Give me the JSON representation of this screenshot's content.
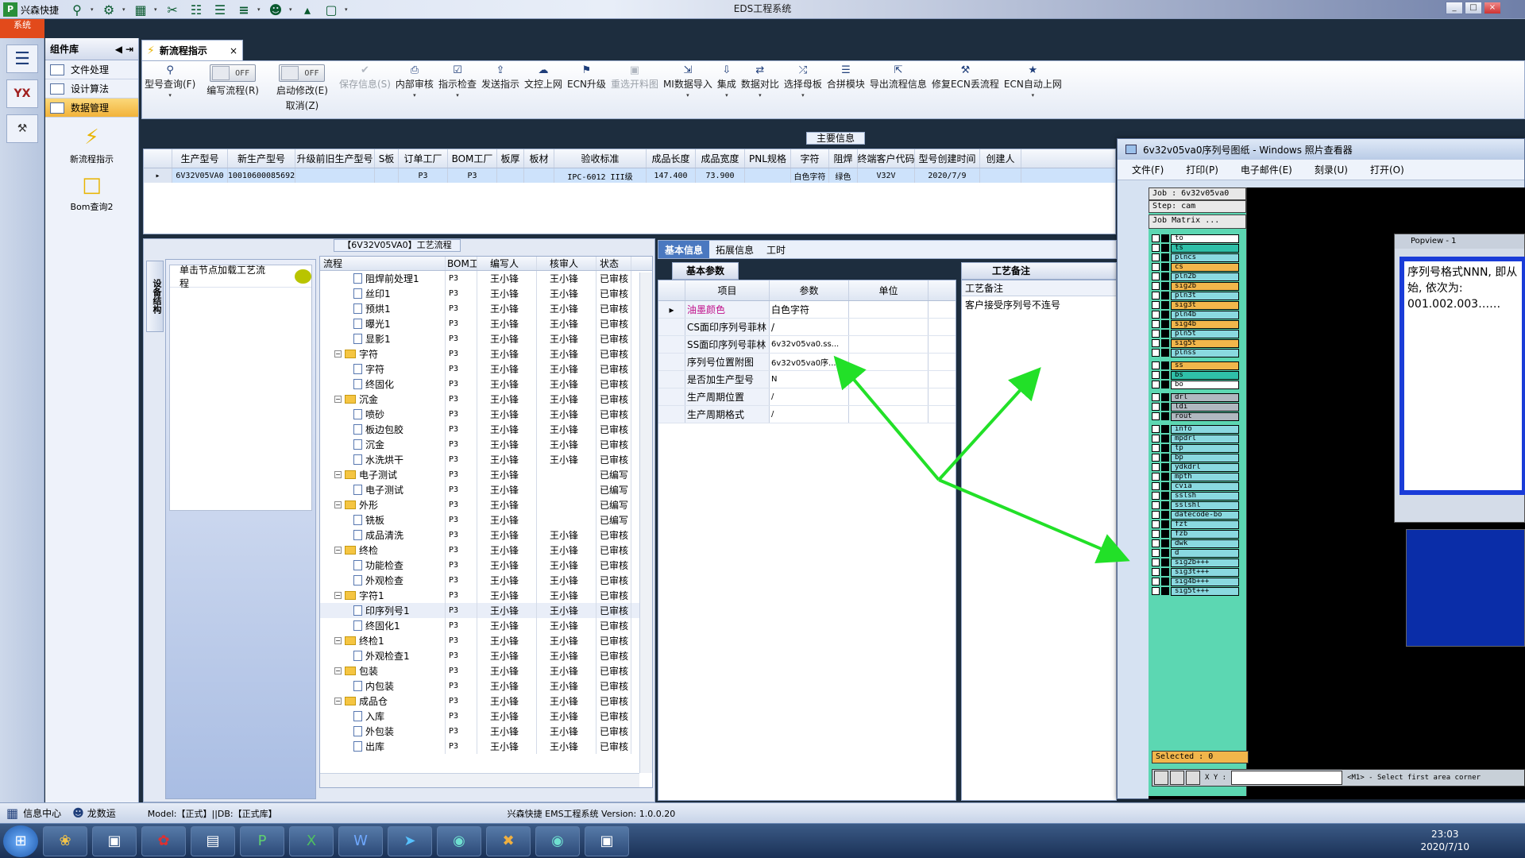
{
  "app": {
    "quick_title": "兴森快捷",
    "window_title": "EDS工程系统",
    "ribbon_tab": "系统"
  },
  "left_icons": [
    {
      "icon": "menu-icon",
      "label": ""
    },
    {
      "icon": "yx-logo-icon",
      "label": "YX"
    },
    {
      "icon": "machine-icon",
      "label": ""
    }
  ],
  "component_panel": {
    "title": "组件库",
    "menu": [
      "文件处理",
      "设计算法",
      "数据管理"
    ],
    "tools": [
      {
        "icon": "lightning-icon",
        "label": "新流程指示"
      },
      {
        "icon": "folder-icon",
        "label": "Bom查询2"
      }
    ]
  },
  "doc_tab": {
    "label": "新流程指示"
  },
  "toolbar": {
    "items": [
      {
        "label": "型号查询(F)",
        "icon": "search-icon",
        "dd": true,
        "dis": false
      },
      {
        "label": "编写流程(R)",
        "toggle": "OFF",
        "dis": false
      },
      {
        "label": "启动修改(E)",
        "label2": "取消(Z)",
        "toggle": "OFF",
        "dis": false
      },
      {
        "label": "保存信息(S)",
        "icon": "check-icon",
        "dis": true
      },
      {
        "label": "内部审核",
        "icon": "print-icon",
        "dd": true,
        "dis": false
      },
      {
        "label": "指示检查",
        "icon": "checkbox-icon",
        "dd": true,
        "dis": false
      },
      {
        "label": "发送指示",
        "icon": "upload-icon",
        "dis": false
      },
      {
        "label": "文控上网",
        "icon": "cloud-upload-icon",
        "dis": false
      },
      {
        "label": "ECN升级",
        "icon": "ecn-icon",
        "dis": false
      },
      {
        "label": "重选开料图",
        "icon": "image-icon",
        "dis": true
      },
      {
        "label": "MI数据导入",
        "icon": "import-icon",
        "dd": true,
        "dis": false
      },
      {
        "label": "集成",
        "icon": "download-icon",
        "dd": true,
        "dis": false
      },
      {
        "label": "数据对比",
        "icon": "compare-icon",
        "dd": true,
        "dis": false
      },
      {
        "label": "选择母板",
        "icon": "shuffle-icon",
        "dd": true,
        "dis": false
      },
      {
        "label": "合拼模块",
        "icon": "list-icon",
        "dis": false
      },
      {
        "label": "导出流程信息",
        "icon": "export-icon",
        "dis": false
      },
      {
        "label": "修复ECN丢流程",
        "icon": "wrench-icon",
        "dis": false
      },
      {
        "label": "ECN自动上网",
        "icon": "star-icon",
        "dd": true,
        "dis": false
      }
    ]
  },
  "main_info": {
    "label": "主要信息",
    "columns": [
      "生产型号",
      "新生产型号",
      "升级前旧生产型号",
      "S板",
      "订单工厂",
      "BOM工厂",
      "板厚",
      "板材",
      "验收标准",
      "成品长度",
      "成品宽度",
      "PNL规格",
      "字符",
      "阻焊",
      "终端客户代码",
      "型号创建时间",
      "创建人"
    ],
    "row": [
      "6V32V05VA0",
      "10010600085692",
      "",
      "",
      "P3",
      "P3",
      "",
      "",
      "IPC-6012 III级",
      "147.400",
      "73.900",
      "",
      "白色字符",
      "绿色",
      "V32V",
      "2020/7/9",
      ""
    ]
  },
  "flow": {
    "title": "【6V32V05VA0】工艺流程",
    "side_tab": "设备结构",
    "load_hint": "单击节点加载工艺流程",
    "columns": [
      "流程",
      "BOM工厂",
      "编写人",
      "核审人",
      "状态"
    ],
    "rows": [
      {
        "name": "阻焊前处理1",
        "lvl": 2,
        "type": "leaf",
        "bom": "P3",
        "writer": "王小锋",
        "checker": "王小锋",
        "status": "已审核"
      },
      {
        "name": "丝印1",
        "lvl": 2,
        "type": "leaf",
        "bom": "P3",
        "writer": "王小锋",
        "checker": "王小锋",
        "status": "已审核"
      },
      {
        "name": "预烘1",
        "lvl": 2,
        "type": "leaf",
        "bom": "P3",
        "writer": "王小锋",
        "checker": "王小锋",
        "status": "已审核"
      },
      {
        "name": "曝光1",
        "lvl": 2,
        "type": "leaf",
        "bom": "P3",
        "writer": "王小锋",
        "checker": "王小锋",
        "status": "已审核"
      },
      {
        "name": "显影1",
        "lvl": 2,
        "type": "leaf",
        "bom": "P3",
        "writer": "王小锋",
        "checker": "王小锋",
        "status": "已审核"
      },
      {
        "name": "字符",
        "lvl": 1,
        "type": "folder",
        "bom": "P3",
        "writer": "王小锋",
        "checker": "王小锋",
        "status": "已审核"
      },
      {
        "name": "字符",
        "lvl": 2,
        "type": "leaf",
        "bom": "P3",
        "writer": "王小锋",
        "checker": "王小锋",
        "status": "已审核"
      },
      {
        "name": "终固化",
        "lvl": 2,
        "type": "leaf",
        "bom": "P3",
        "writer": "王小锋",
        "checker": "王小锋",
        "status": "已审核"
      },
      {
        "name": "沉金",
        "lvl": 1,
        "type": "folder",
        "bom": "P3",
        "writer": "王小锋",
        "checker": "王小锋",
        "status": "已审核"
      },
      {
        "name": "喷砂",
        "lvl": 2,
        "type": "leaf",
        "bom": "P3",
        "writer": "王小锋",
        "checker": "王小锋",
        "status": "已审核"
      },
      {
        "name": "板边包胶",
        "lvl": 2,
        "type": "leaf",
        "bom": "P3",
        "writer": "王小锋",
        "checker": "王小锋",
        "status": "已审核"
      },
      {
        "name": "沉金",
        "lvl": 2,
        "type": "leaf",
        "bom": "P3",
        "writer": "王小锋",
        "checker": "王小锋",
        "status": "已审核"
      },
      {
        "name": "水洗烘干",
        "lvl": 2,
        "type": "leaf",
        "bom": "P3",
        "writer": "王小锋",
        "checker": "王小锋",
        "status": "已审核"
      },
      {
        "name": "电子测试",
        "lvl": 1,
        "type": "folder",
        "bom": "P3",
        "writer": "王小锋",
        "checker": "",
        "status": "已编写"
      },
      {
        "name": "电子测试",
        "lvl": 2,
        "type": "leaf",
        "bom": "P3",
        "writer": "王小锋",
        "checker": "",
        "status": "已编写"
      },
      {
        "name": "外形",
        "lvl": 1,
        "type": "folder",
        "bom": "P3",
        "writer": "王小锋",
        "checker": "",
        "status": "已编写"
      },
      {
        "name": "铣板",
        "lvl": 2,
        "type": "leaf",
        "bom": "P3",
        "writer": "王小锋",
        "checker": "",
        "status": "已编写"
      },
      {
        "name": "成品清洗",
        "lvl": 2,
        "type": "leaf",
        "bom": "P3",
        "writer": "王小锋",
        "checker": "王小锋",
        "status": "已审核"
      },
      {
        "name": "终检",
        "lvl": 1,
        "type": "folder",
        "bom": "P3",
        "writer": "王小锋",
        "checker": "王小锋",
        "status": "已审核"
      },
      {
        "name": "功能检查",
        "lvl": 2,
        "type": "leaf",
        "bom": "P3",
        "writer": "王小锋",
        "checker": "王小锋",
        "status": "已审核"
      },
      {
        "name": "外观检查",
        "lvl": 2,
        "type": "leaf",
        "bom": "P3",
        "writer": "王小锋",
        "checker": "王小锋",
        "status": "已审核"
      },
      {
        "name": "字符1",
        "lvl": 1,
        "type": "folder",
        "bom": "P3",
        "writer": "王小锋",
        "checker": "王小锋",
        "status": "已审核"
      },
      {
        "name": "印序列号1",
        "lvl": 2,
        "type": "leaf",
        "bom": "P3",
        "writer": "王小锋",
        "checker": "王小锋",
        "status": "已审核",
        "sel": true
      },
      {
        "name": "终固化1",
        "lvl": 2,
        "type": "leaf",
        "bom": "P3",
        "writer": "王小锋",
        "checker": "王小锋",
        "status": "已审核"
      },
      {
        "name": "终检1",
        "lvl": 1,
        "type": "folder",
        "bom": "P3",
        "writer": "王小锋",
        "checker": "王小锋",
        "status": "已审核"
      },
      {
        "name": "外观检查1",
        "lvl": 2,
        "type": "leaf",
        "bom": "P3",
        "writer": "王小锋",
        "checker": "王小锋",
        "status": "已审核"
      },
      {
        "name": "包装",
        "lvl": 1,
        "type": "folder",
        "bom": "P3",
        "writer": "王小锋",
        "checker": "王小锋",
        "status": "已审核"
      },
      {
        "name": "内包装",
        "lvl": 2,
        "type": "leaf",
        "bom": "P3",
        "writer": "王小锋",
        "checker": "王小锋",
        "status": "已审核"
      },
      {
        "name": "成品仓",
        "lvl": 1,
        "type": "folder",
        "bom": "P3",
        "writer": "王小锋",
        "checker": "王小锋",
        "status": "已审核"
      },
      {
        "name": "入库",
        "lvl": 2,
        "type": "leaf",
        "bom": "P3",
        "writer": "王小锋",
        "checker": "王小锋",
        "status": "已审核"
      },
      {
        "name": "外包装",
        "lvl": 2,
        "type": "leaf",
        "bom": "P3",
        "writer": "王小锋",
        "checker": "王小锋",
        "status": "已审核"
      },
      {
        "name": "出库",
        "lvl": 2,
        "type": "leaf",
        "bom": "P3",
        "writer": "王小锋",
        "checker": "王小锋",
        "status": "已审核"
      }
    ]
  },
  "info_tabs": [
    "基本信息",
    "拓展信息",
    "工时"
  ],
  "params": {
    "title": "基本参数",
    "columns": [
      "项目",
      "参数",
      "单位"
    ],
    "rows": [
      {
        "k": "油墨颜色",
        "v": "白色字符",
        "u": "",
        "hl": true
      },
      {
        "k": "CS面印序列号菲林",
        "v": "/",
        "u": ""
      },
      {
        "k": "SS面印序列号菲林",
        "v": "6v32v05va0.ss...",
        "u": ""
      },
      {
        "k": "序列号位置附图",
        "v": "6v32v05va0序...",
        "u": ""
      },
      {
        "k": "是否加生产型号",
        "v": "N",
        "u": ""
      },
      {
        "k": "生产周期位置",
        "v": "/",
        "u": ""
      },
      {
        "k": "生产周期格式",
        "v": "/",
        "u": ""
      }
    ]
  },
  "remark": {
    "title": "工艺备注",
    "label": "工艺备注",
    "text": "客户接受序列号不连号"
  },
  "status_bar": {
    "info_center": "信息中心",
    "user": "龙数运",
    "model": "Model:【正式】||DB:【正式库】",
    "version": "兴森快捷 EMS工程系统 Version: 1.0.0.20"
  },
  "viewer": {
    "title": "6v32v05va0序列号图纸 - Windows 照片查看器",
    "menu": [
      "文件(F)",
      "打印(P)",
      "电子邮件(E)",
      "刻录(U)",
      "打开(O)"
    ],
    "job": "Job : 6v32v05va0",
    "step": "Step: cam",
    "matrix_btn": "Job Matrix ...",
    "layers": [
      {
        "n": "to",
        "c": "#ffffff"
      },
      {
        "n": "ts",
        "c": "#2fc0a8"
      },
      {
        "n": "plncs",
        "c": "#8ad9e0"
      },
      {
        "n": "cs",
        "c": "#f2b64b"
      },
      {
        "n": "pln2b",
        "c": "#8ad9e0"
      },
      {
        "n": "sig2b",
        "c": "#f2b64b"
      },
      {
        "n": "pln3t",
        "c": "#8ad9e0"
      },
      {
        "n": "sig3t",
        "c": "#f2b64b"
      },
      {
        "n": "pln4b",
        "c": "#8ad9e0"
      },
      {
        "n": "sig4b",
        "c": "#f2b64b"
      },
      {
        "n": "pln5t",
        "c": "#8ad9e0"
      },
      {
        "n": "sig5t",
        "c": "#f2b64b"
      },
      {
        "n": "plnss",
        "c": "#8ad9e0"
      },
      {
        "n": "ss",
        "c": "#f2b64b"
      },
      {
        "n": "bs",
        "c": "#2fc0a8"
      },
      {
        "n": "bo",
        "c": "#ffffff"
      },
      {
        "n": "drl",
        "c": "#b0b8c0"
      },
      {
        "n": "ldi",
        "c": "#b0b8c0"
      },
      {
        "n": "rout",
        "c": "#b0b8c0"
      },
      {
        "n": "info",
        "c": "#8ad9e0"
      },
      {
        "n": "mpdrl",
        "c": "#8ad9e0"
      },
      {
        "n": "tp",
        "c": "#8ad9e0"
      },
      {
        "n": "bp",
        "c": "#8ad9e0"
      },
      {
        "n": "ydkdrl",
        "c": "#8ad9e0"
      },
      {
        "n": "mpth",
        "c": "#8ad9e0"
      },
      {
        "n": "cvia",
        "c": "#8ad9e0"
      },
      {
        "n": "sslsh",
        "c": "#8ad9e0"
      },
      {
        "n": "sslshl",
        "c": "#8ad9e0"
      },
      {
        "n": "datecode-bo",
        "c": "#8ad9e0"
      },
      {
        "n": "fzt",
        "c": "#8ad9e0"
      },
      {
        "n": "fzb",
        "c": "#8ad9e0"
      },
      {
        "n": "dwk",
        "c": "#8ad9e0"
      },
      {
        "n": "d",
        "c": "#8ad9e0"
      },
      {
        "n": "sig2b+++",
        "c": "#8ad9e0"
      },
      {
        "n": "sig3t+++",
        "c": "#8ad9e0"
      },
      {
        "n": "sig4b+++",
        "c": "#8ad9e0"
      },
      {
        "n": "sig5t+++",
        "c": "#8ad9e0"
      }
    ],
    "popview_title": "Popview - 1",
    "popview_text": "序列号格式NNN, 即从始, 依次为: 001.002.003……",
    "selected": "Selected : 0",
    "xy_label": "X Y :",
    "cmd_hint": "<M1> - Select first area corner"
  },
  "taskbar": {
    "time": "23:03",
    "date": "2020/7/10"
  },
  "colors": {
    "arrow": "#22e028",
    "accent": "#f2b33a",
    "highlight_text": "#c0108a"
  }
}
